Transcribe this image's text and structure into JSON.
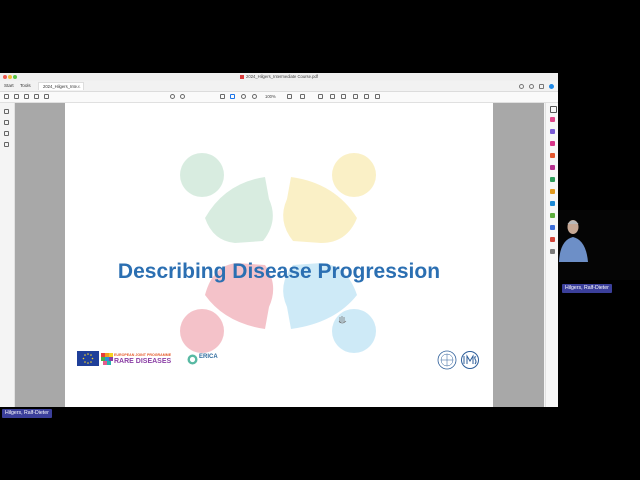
{
  "window": {
    "document_title": "2024_Hilgers_Intermediate Course.pdf"
  },
  "tabs": {
    "start": "Start",
    "tools": "Tools",
    "document": "2024_Hilgers_Inte...",
    "close": "×"
  },
  "toolbar": {
    "page_indicator": "",
    "zoom_value": "100%"
  },
  "slide": {
    "title": "Describing Disease Progression",
    "ejp_line1": "EUROPEAN JOINT PROGRAMME",
    "ejp_line2": "RARE DISEASES",
    "erica_name": "ERICA",
    "colors": {
      "title": "#2b6fb2",
      "puzzle_green": "#8cc8a4",
      "puzzle_yellow": "#f2d256",
      "puzzle_red": "#e04a5e",
      "puzzle_blue": "#6cc0e8"
    }
  },
  "participant": {
    "name": "Hilgers, Ralf-Dieter"
  }
}
